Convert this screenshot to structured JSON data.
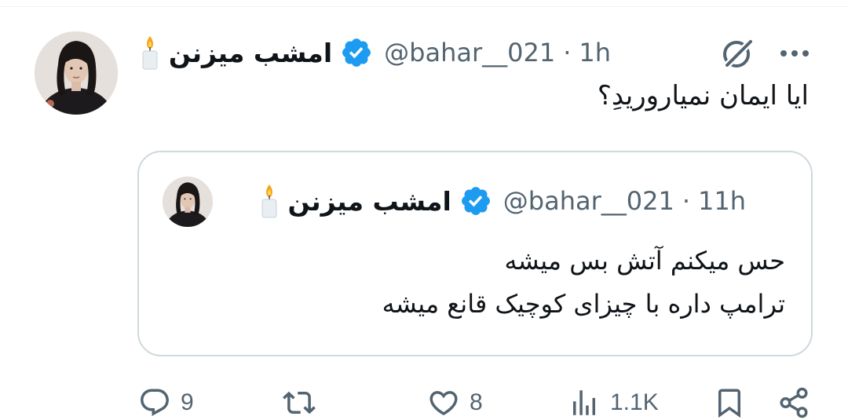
{
  "tweet": {
    "display_name": "امشب میزنن",
    "handle": "@bahar__021",
    "separator": "·",
    "time": "1h",
    "text": "ایا ایمان نمیاروریدِ؟"
  },
  "quoted": {
    "display_name": "امشب میزنن",
    "handle": "@bahar__021",
    "separator": "·",
    "time": "11h",
    "line1": "حس میکنم آتش بس میشه",
    "line2": "ترامپ داره با چیزای کوچیک قانع میشه"
  },
  "actions": {
    "replies": "9",
    "reposts": "",
    "likes": "8",
    "views": "1.1K"
  },
  "colors": {
    "verified": "#1d9bf0",
    "meta_gray": "#536471",
    "border": "#cfd9de",
    "text": "#0f1419"
  },
  "icons": [
    "candle-emoji-icon",
    "verified-badge-icon",
    "grok-icon",
    "more-icon",
    "reply-icon",
    "repost-icon",
    "like-icon",
    "views-icon",
    "bookmark-icon",
    "share-icon"
  ]
}
